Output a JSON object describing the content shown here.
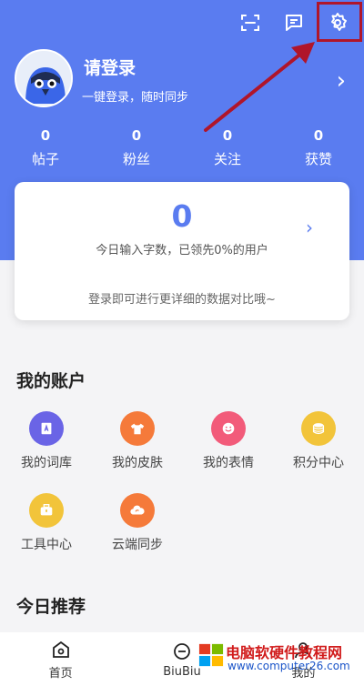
{
  "header": {
    "login_title": "请登录",
    "login_subtitle": "一键登录，随时同步",
    "top_icons": [
      "scan-icon",
      "message-icon",
      "settings-icon"
    ]
  },
  "stats": [
    {
      "value": "0",
      "label": "帖子"
    },
    {
      "value": "0",
      "label": "粉丝"
    },
    {
      "value": "0",
      "label": "关注"
    },
    {
      "value": "0",
      "label": "获赞"
    }
  ],
  "card": {
    "count": "0",
    "summary": "今日输入字数，已领先0%的用户",
    "hint": "登录即可进行更详细的数据对比哦~"
  },
  "account": {
    "title": "我的账户",
    "items": [
      {
        "label": "我的词库",
        "icon": "dictionary-icon",
        "color": "#6a64e6"
      },
      {
        "label": "我的皮肤",
        "icon": "skin-icon",
        "color": "#f57a3a"
      },
      {
        "label": "我的表情",
        "icon": "emoji-icon",
        "color": "#f25b7a"
      },
      {
        "label": "积分中心",
        "icon": "points-icon",
        "color": "#f2c43a"
      },
      {
        "label": "工具中心",
        "icon": "toolbox-icon",
        "color": "#f2c43a"
      },
      {
        "label": "云端同步",
        "icon": "cloud-sync-icon",
        "color": "#f57a3a"
      }
    ]
  },
  "recommend": {
    "title": "今日推荐"
  },
  "tabs": [
    {
      "label": "首页",
      "icon": "home-icon"
    },
    {
      "label": "BiuBiu",
      "icon": "biubiu-icon"
    },
    {
      "label": "我的",
      "icon": "profile-icon"
    }
  ],
  "watermark": {
    "text": "电脑软硬件教程网",
    "url": "www.computer26.com"
  },
  "colors": {
    "primary": "#5a7cf0",
    "annotation": "#b0152a"
  }
}
